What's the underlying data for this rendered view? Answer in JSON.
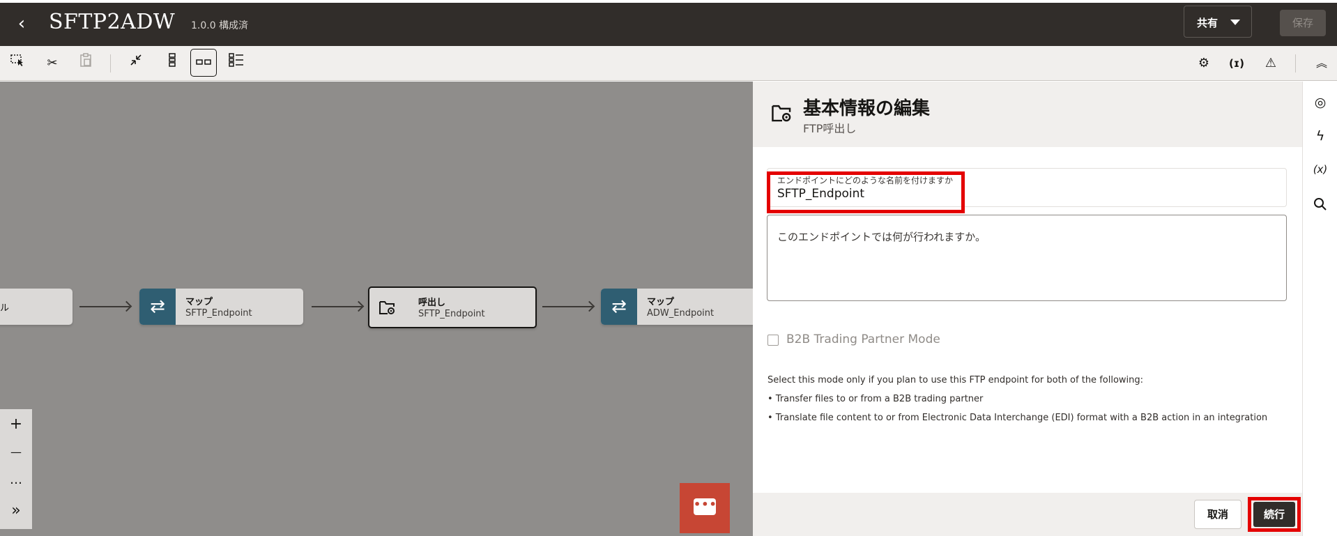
{
  "header": {
    "back_icon": "chevron-left-icon",
    "title": "SFTP2ADW",
    "version": "1.0.0 構成済",
    "share_label": "共有",
    "save_label": "保存"
  },
  "toolbar": {
    "left_icons": [
      "select-area-icon",
      "cut-icon",
      "paste-icon",
      "collapse-icon",
      "vertical-layout-icon",
      "horizontal-layout-icon",
      "list-layout-icon"
    ],
    "right_icons": [
      "gear-icon",
      "variable-icon",
      "warning-icon",
      "chevrons-up-icon"
    ]
  },
  "canvas": {
    "nodes": [
      {
        "title": "ル",
        "subtitle": ""
      },
      {
        "title": "マップ",
        "subtitle": "SFTP_Endpoint"
      },
      {
        "title": "呼出し",
        "subtitle": "SFTP_Endpoint"
      },
      {
        "title": "マップ",
        "subtitle": "ADW_Endpoint"
      }
    ],
    "zoom": {
      "in": "+",
      "out": "—",
      "more": "…",
      "expand": "»"
    }
  },
  "panel": {
    "title": "基本情報の編集",
    "subtitle": "FTP呼出し",
    "name_field": {
      "label": "エンドポイントにどのような名前を付けますか",
      "value": "SFTP_Endpoint"
    },
    "description_placeholder": "このエンドポイントでは何が行われますか。",
    "b2b_checkbox_label": "B2B Trading Partner Mode",
    "b2b_checked": false,
    "help_lines": [
      "Select this mode only if you plan to use this FTP endpoint for both of the following:",
      "• Transfer files to or from a B2B trading partner",
      "• Translate file content to or from Electronic Data Interchange (EDI) format with a B2B action in an integration"
    ],
    "cancel_label": "取消",
    "continue_label": "続行"
  },
  "right_rail": {
    "icons": [
      "target-icon",
      "lightning-icon",
      "variable-x-icon",
      "search-icon"
    ]
  },
  "colors": {
    "topbar": "#312d2a",
    "canvas_overlay": "#8f8d8b",
    "map_icon_bg": "#2f5e72",
    "chat_button": "#c74634",
    "highlight": "#e40000"
  }
}
